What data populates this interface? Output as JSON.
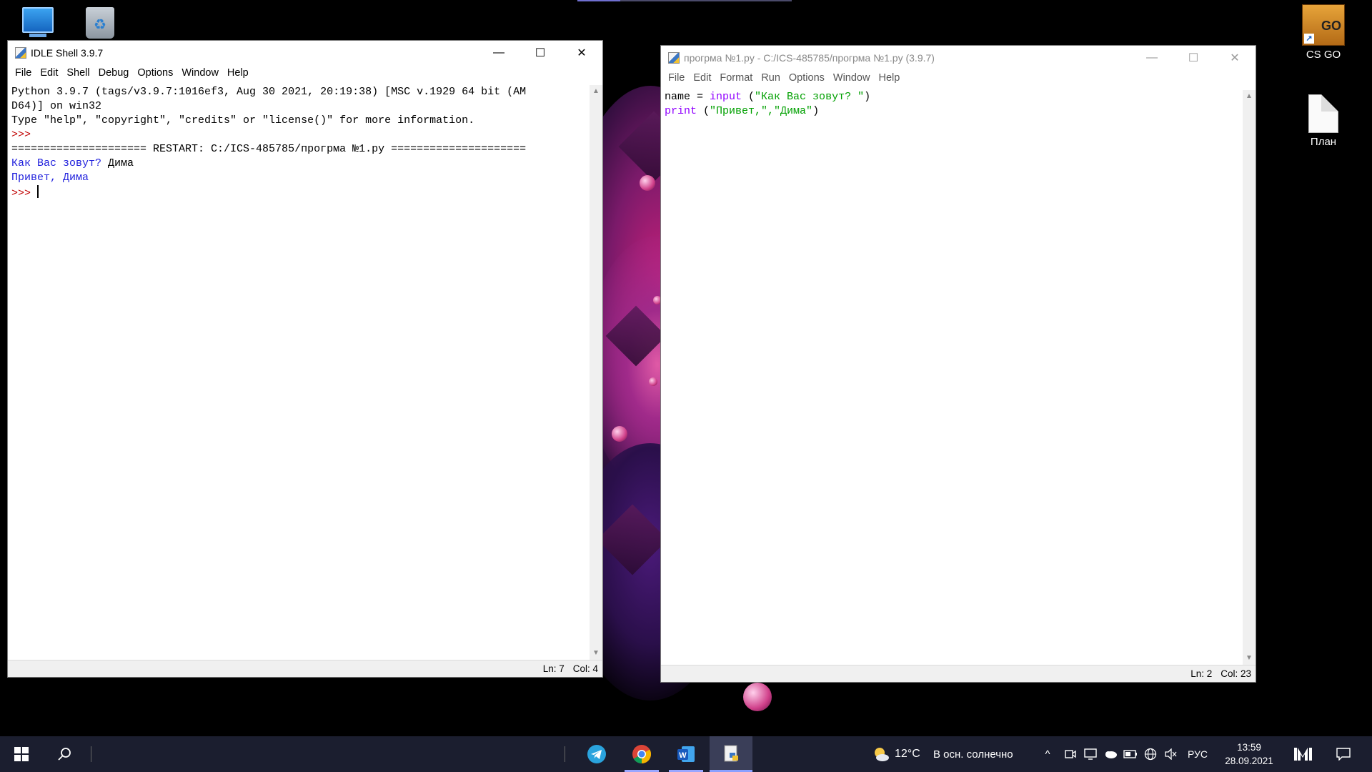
{
  "desktop": {
    "icons": [
      {
        "label": "",
        "icon": "computer-icon"
      },
      {
        "label": "",
        "icon": "recycle-bin-icon"
      },
      {
        "label": "CS GO",
        "icon": "csgo-icon"
      },
      {
        "label": "План",
        "icon": "document-icon"
      }
    ]
  },
  "shell_window": {
    "title": "IDLE Shell 3.9.7",
    "menu": [
      "File",
      "Edit",
      "Shell",
      "Debug",
      "Options",
      "Window",
      "Help"
    ],
    "lines": [
      "Python 3.9.7 (tags/v3.9.7:1016ef3, Aug 30 2021, 20:19:38) [MSC v.1929 64 bit (AM",
      "D64)] on win32",
      "Type \"help\", \"copyright\", \"credits\" or \"license()\" for more information.",
      ">>> ",
      "===================== RESTART: C:/ICS-485785/прогрма №1.py ====================="
    ],
    "prompt_text": "Как Вас зовут?",
    "user_input": " Дима",
    "output": "Привет, Дима",
    "prompt": ">>> ",
    "status": {
      "ln": "Ln: 7",
      "col": "Col: 4"
    }
  },
  "editor_window": {
    "title": "прогрма №1.py - C:/ICS-485785/прогрма №1.py (3.9.7)",
    "menu": [
      "File",
      "Edit",
      "Format",
      "Run",
      "Options",
      "Window",
      "Help"
    ],
    "code": {
      "line1": {
        "var": "name = ",
        "func": "input",
        "rest": " (",
        "str": "\"Как Вас зовут? \"",
        "end": ")"
      },
      "line2": {
        "func": "print",
        "rest": " (",
        "str": "\"Привет,\",\"Дима\"",
        "end": ")"
      }
    },
    "status": {
      "ln": "Ln: 2",
      "col": "Col: 23"
    }
  },
  "taskbar": {
    "pinned": [
      "telegram-icon",
      "chrome-icon",
      "word-icon",
      "idle-icon"
    ],
    "weather_temp": "12°C",
    "weather_text": "В осн. солнечно",
    "language": "РУС",
    "time": "13:59",
    "date": "28.09.2021"
  }
}
